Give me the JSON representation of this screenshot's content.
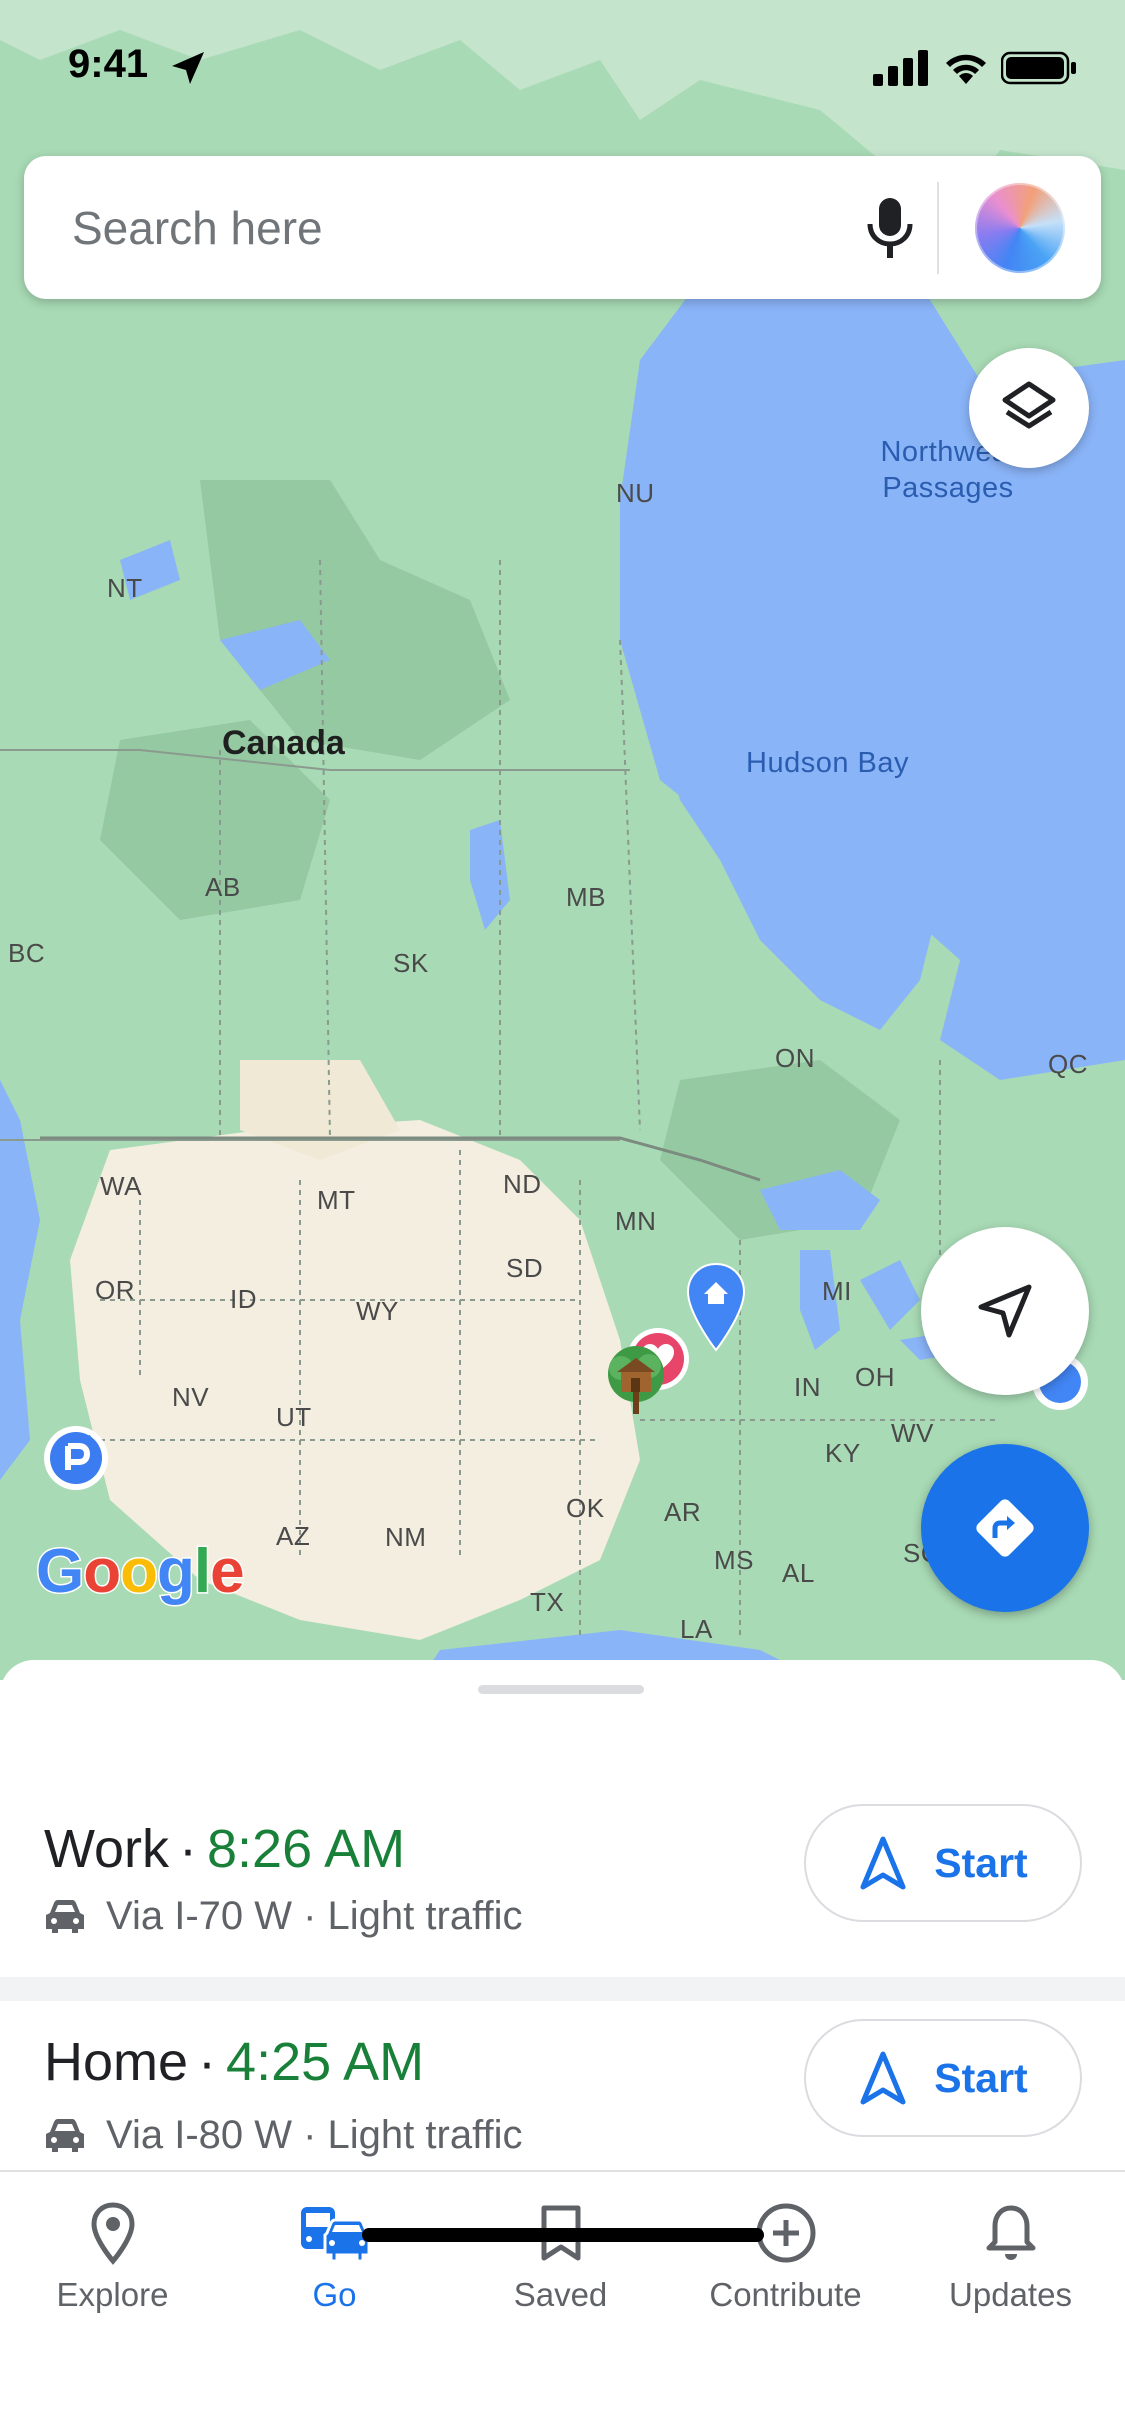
{
  "status_bar": {
    "time": "9:41"
  },
  "search": {
    "placeholder": "Search here"
  },
  "map": {
    "labels": {
      "canada": "Canada",
      "nu": "NU",
      "nt": "NT",
      "northwest_passages": "Northwest\nPassages",
      "hudson_bay": "Hudson Bay",
      "ab": "AB",
      "bc": "BC",
      "mb": "MB",
      "sk": "SK",
      "on": "ON",
      "qc": "QC",
      "wa": "WA",
      "mt": "MT",
      "nd": "ND",
      "mn": "MN",
      "sd": "SD",
      "or": "OR",
      "id": "ID",
      "wy": "WY",
      "mi": "MI",
      "nv": "NV",
      "ut": "UT",
      "in": "IN",
      "oh": "OH",
      "wv": "WV",
      "ky": "KY",
      "ok": "OK",
      "ar": "AR",
      "az": "AZ",
      "nm": "NM",
      "ms": "MS",
      "al": "AL",
      "sc": "SC",
      "tx": "TX",
      "la": "LA"
    },
    "google_logo": [
      "G",
      "o",
      "o",
      "g",
      "l",
      "e"
    ],
    "google_logo_colors": [
      "#4285f4",
      "#ea4335",
      "#fbbc05",
      "#4285f4",
      "#34a853",
      "#ea4335"
    ],
    "pins": [
      "home-pin-icon",
      "favorite-heart-pin-icon",
      "treehouse-pin-icon",
      "parking-pin-icon"
    ]
  },
  "trips": [
    {
      "destination": "Work",
      "separator": "·",
      "eta": "8:26 AM",
      "route": "Via I-70 W · Light traffic",
      "start_label": "Start"
    },
    {
      "destination": "Home",
      "separator": "·",
      "eta": "4:25 AM",
      "route": "Via I-80 W · Light traffic",
      "start_label": "Start"
    }
  ],
  "nav": {
    "items": [
      {
        "label": "Explore",
        "icon": "location-pin-icon",
        "active": false
      },
      {
        "label": "Go",
        "icon": "commute-icon",
        "active": true
      },
      {
        "label": "Saved",
        "icon": "bookmark-icon",
        "active": false
      },
      {
        "label": "Contribute",
        "icon": "add-circle-icon",
        "active": false
      },
      {
        "label": "Updates",
        "icon": "bell-icon",
        "active": false
      }
    ]
  },
  "colors": {
    "accent_blue": "#1a73e8",
    "eta_green": "#188038",
    "water": "#8ab4f8",
    "land_green": "#a8dab5"
  }
}
